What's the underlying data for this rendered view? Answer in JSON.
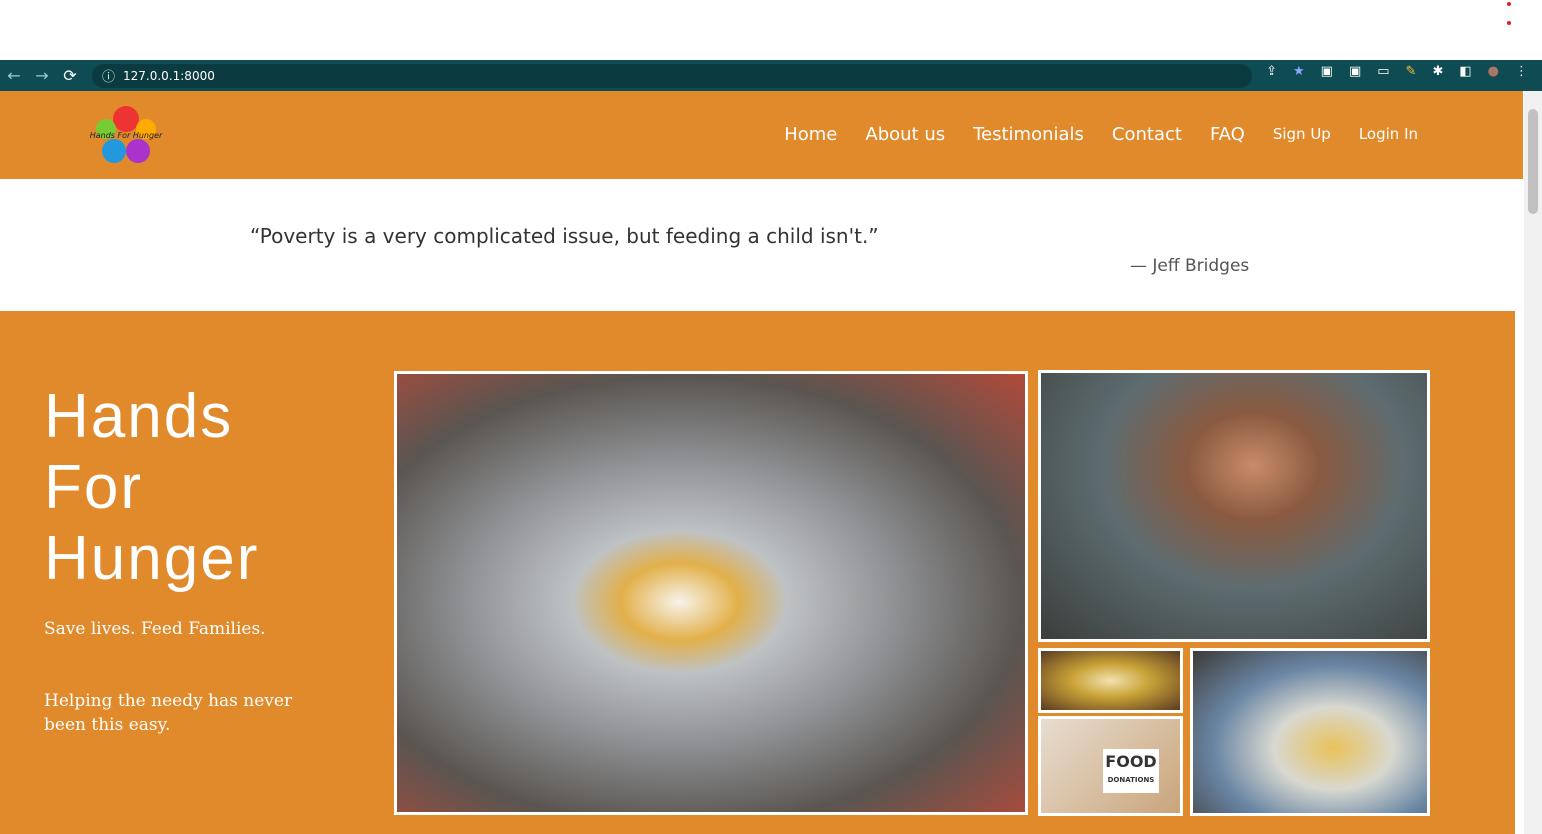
{
  "browser": {
    "url": "127.0.0.1:8000"
  },
  "nav": {
    "items": [
      "Home",
      "About us",
      "Testimonials",
      "Contact",
      "FAQ"
    ],
    "signup": "Sign Up",
    "login": "Login In",
    "logo_text": "Hands For Hunger"
  },
  "quote": {
    "text": "“Poverty is a very complicated issue, but feeding a child isn't.”",
    "author": "— Jeff Bridges"
  },
  "hero": {
    "title_lines": [
      "Hands",
      "For",
      "Hunger"
    ],
    "tagline": "Save lives. Feed Families.",
    "subtext": "Helping the needy has never been this easy.",
    "image_text": {
      "big": "FOOD",
      "small": "DONATIONS"
    }
  },
  "colors": {
    "brand": "#e08a2c",
    "browser": "#0f4b52"
  }
}
